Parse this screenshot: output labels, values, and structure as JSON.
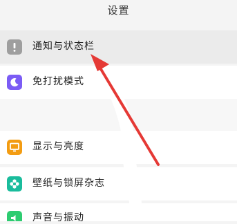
{
  "header": {
    "title": "设置"
  },
  "items": [
    {
      "label": "通知与状态栏",
      "icon": "exclamation-icon",
      "color": "#9e9e9e"
    },
    {
      "label": "免打扰模式",
      "icon": "moon-icon",
      "color": "#7b5cf5"
    },
    {
      "label": "显示与亮度",
      "icon": "monitor-icon",
      "color": "#f39c12"
    },
    {
      "label": "壁纸与锁屏杂志",
      "icon": "flower-icon",
      "color": "#1abc9c"
    },
    {
      "label": "声音与振动",
      "icon": "speaker-icon",
      "color": "#2ecc71"
    }
  ],
  "annotation": {
    "arrow_color": "#e53935"
  }
}
